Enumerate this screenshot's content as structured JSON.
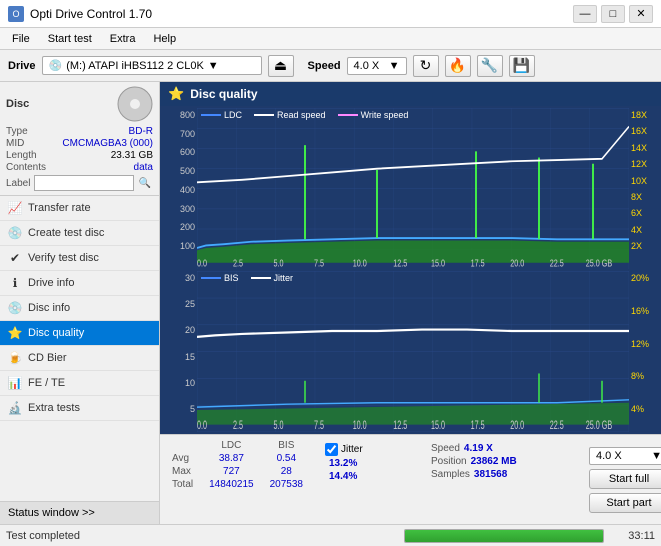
{
  "titlebar": {
    "title": "Opti Drive Control 1.70",
    "minimize": "—",
    "maximize": "□",
    "close": "✕"
  },
  "menu": {
    "items": [
      "File",
      "Start test",
      "Extra",
      "Help"
    ]
  },
  "drivebar": {
    "label": "Drive",
    "drive_text": "(M:)  ATAPI iHBS112  2 CL0K",
    "speed_label": "Speed",
    "speed_value": "4.0 X"
  },
  "disc": {
    "type_label": "Type",
    "type_val": "BD-R",
    "mid_label": "MID",
    "mid_val": "CMCMAGBA3 (000)",
    "length_label": "Length",
    "length_val": "23.31 GB",
    "contents_label": "Contents",
    "contents_val": "data",
    "label_label": "Label",
    "label_placeholder": ""
  },
  "nav": {
    "items": [
      {
        "id": "transfer-rate",
        "label": "Transfer rate",
        "icon": "📈"
      },
      {
        "id": "create-test-disc",
        "label": "Create test disc",
        "icon": "💿"
      },
      {
        "id": "verify-test-disc",
        "label": "Verify test disc",
        "icon": "✔"
      },
      {
        "id": "drive-info",
        "label": "Drive info",
        "icon": "ℹ"
      },
      {
        "id": "disc-info",
        "label": "Disc info",
        "icon": "💿"
      },
      {
        "id": "disc-quality",
        "label": "Disc quality",
        "icon": "⭐",
        "active": true
      },
      {
        "id": "cd-bier",
        "label": "CD Bier",
        "icon": "🍺"
      },
      {
        "id": "fe-te",
        "label": "FE / TE",
        "icon": "📊"
      },
      {
        "id": "extra-tests",
        "label": "Extra tests",
        "icon": "🔬"
      }
    ]
  },
  "disc_quality": {
    "header": "Disc quality",
    "chart1": {
      "legend": [
        "LDC",
        "Read speed",
        "Write speed"
      ],
      "y_left": [
        "800",
        "700",
        "600",
        "500",
        "400",
        "300",
        "200",
        "100"
      ],
      "y_right": [
        "18X",
        "16X",
        "14X",
        "12X",
        "10X",
        "8X",
        "6X",
        "4X",
        "2X"
      ],
      "x_labels": [
        "0.0",
        "2.5",
        "5.0",
        "7.5",
        "10.0",
        "12.5",
        "15.0",
        "17.5",
        "20.0",
        "22.5",
        "25.0 GB"
      ]
    },
    "chart2": {
      "legend": [
        "BIS",
        "Jitter"
      ],
      "y_left": [
        "30",
        "25",
        "20",
        "15",
        "10",
        "5"
      ],
      "y_right": [
        "20%",
        "16%",
        "12%",
        "8%",
        "4%"
      ],
      "x_labels": [
        "0.0",
        "2.5",
        "5.0",
        "7.5",
        "10.0",
        "12.5",
        "15.0",
        "17.5",
        "20.0",
        "22.5",
        "25.0 GB"
      ]
    }
  },
  "stats": {
    "headers": [
      "",
      "LDC",
      "BIS"
    ],
    "rows": [
      {
        "label": "Avg",
        "ldc": "38.87",
        "bis": "0.54"
      },
      {
        "label": "Max",
        "ldc": "727",
        "bis": "28"
      },
      {
        "label": "Total",
        "ldc": "14840215",
        "bis": "207538"
      }
    ],
    "jitter_checked": true,
    "jitter_label": "Jitter",
    "jitter_avg": "13.2%",
    "jitter_max": "14.4%",
    "speed_label": "Speed",
    "speed_value": "4.19 X",
    "position_label": "Position",
    "position_value": "23862 MB",
    "samples_label": "Samples",
    "samples_value": "381568",
    "speed_selector": "4.0 X",
    "start_full": "Start full",
    "start_part": "Start part"
  },
  "status_window_label": "Status window >>",
  "bottombar": {
    "status": "Test completed",
    "progress": 100,
    "time": "33:11"
  },
  "colors": {
    "accent_blue": "#0078d7",
    "chart_bg": "#1e3a6b",
    "ldc_color": "#44aaff",
    "read_color": "#ffffff",
    "bis_color": "#44aaff",
    "jitter_color": "#ffffff",
    "green_fill": "#44cc44",
    "yellow_accent": "#ffd700"
  }
}
